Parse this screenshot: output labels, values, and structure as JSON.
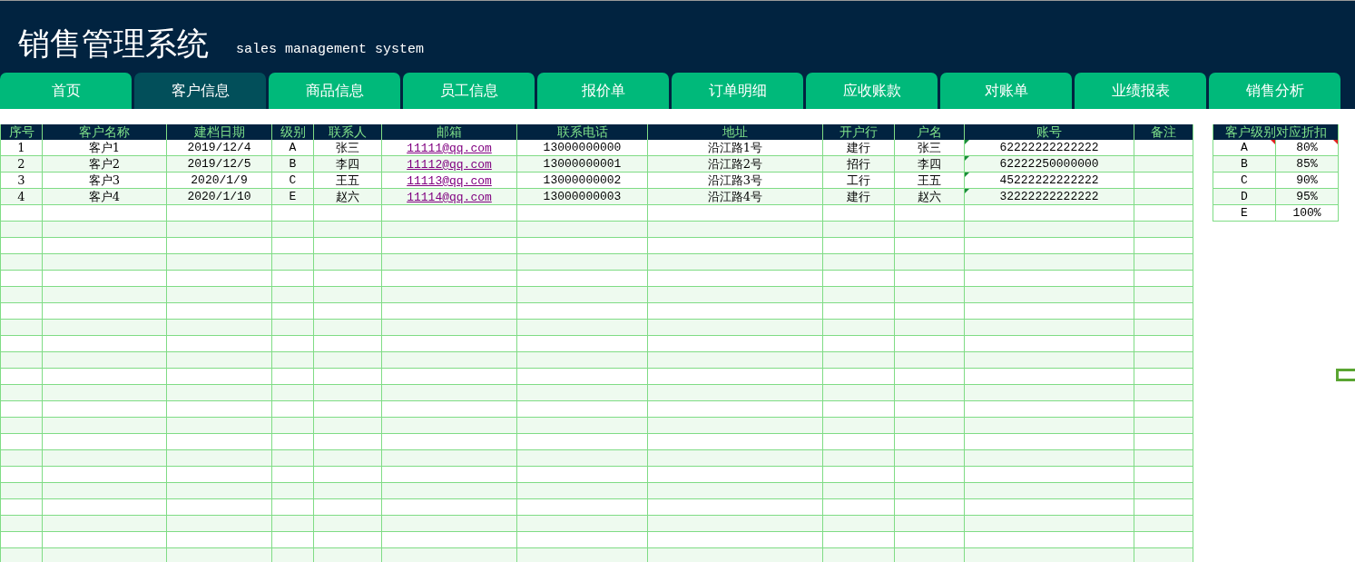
{
  "header": {
    "title": "销售管理系统",
    "subtitle": "sales management system"
  },
  "tabs": [
    {
      "label": "首页",
      "selected": false
    },
    {
      "label": "客户信息",
      "selected": true
    },
    {
      "label": "商品信息",
      "selected": false
    },
    {
      "label": "员工信息",
      "selected": false
    },
    {
      "label": "报价单",
      "selected": false
    },
    {
      "label": "订单明细",
      "selected": false
    },
    {
      "label": "应收账款",
      "selected": false
    },
    {
      "label": "对账单",
      "selected": false
    },
    {
      "label": "业绩报表",
      "selected": false
    },
    {
      "label": "销售分析",
      "selected": false
    }
  ],
  "table": {
    "columns": [
      {
        "label": "序号",
        "kind": "text"
      },
      {
        "label": "客户名称",
        "kind": "text"
      },
      {
        "label": "建档日期",
        "kind": "text"
      },
      {
        "label": "级别",
        "kind": "text"
      },
      {
        "label": "联系人",
        "kind": "text"
      },
      {
        "label": "邮箱",
        "kind": "link"
      },
      {
        "label": "联系电话",
        "kind": "text"
      },
      {
        "label": "地址",
        "kind": "text"
      },
      {
        "label": "开户行",
        "kind": "text"
      },
      {
        "label": "户名",
        "kind": "text"
      },
      {
        "label": "账号",
        "kind": "text"
      },
      {
        "label": "备注",
        "kind": "text"
      }
    ],
    "rows": [
      {
        "cells": [
          "1",
          "客户1",
          "2019/12/4",
          "A",
          "张三",
          "11111@qq.com",
          "13000000000",
          "沿江路1号",
          "建行",
          "张三",
          "62222222222222",
          ""
        ],
        "flagged": true
      },
      {
        "cells": [
          "2",
          "客户2",
          "2019/12/5",
          "B",
          "李四",
          "11112@qq.com",
          "13000000001",
          "沿江路2号",
          "招行",
          "李四",
          "62222250000000",
          ""
        ],
        "flagged": true
      },
      {
        "cells": [
          "3",
          "客户3",
          "2020/1/9",
          "C",
          "王五",
          "11113@qq.com",
          "13000000002",
          "沿江路3号",
          "工行",
          "王五",
          "45222222222222",
          ""
        ],
        "flagged": true
      },
      {
        "cells": [
          "4",
          "客户4",
          "2020/1/10",
          "E",
          "赵六",
          "11114@qq.com",
          "13000000003",
          "沿江路4号",
          "建行",
          "赵六",
          "32222222222222",
          ""
        ],
        "flagged": true
      }
    ]
  },
  "discount_table": {
    "title": "客户级别对应折扣",
    "rows": [
      {
        "cells": [
          "A",
          "80%"
        ],
        "commented": true
      },
      {
        "cells": [
          "B",
          "85%"
        ],
        "commented": false
      },
      {
        "cells": [
          "C",
          "90%"
        ],
        "commented": false
      },
      {
        "cells": [
          "D",
          "95%"
        ],
        "commented": false
      },
      {
        "cells": [
          "E",
          "100%"
        ],
        "commented": false
      }
    ]
  }
}
